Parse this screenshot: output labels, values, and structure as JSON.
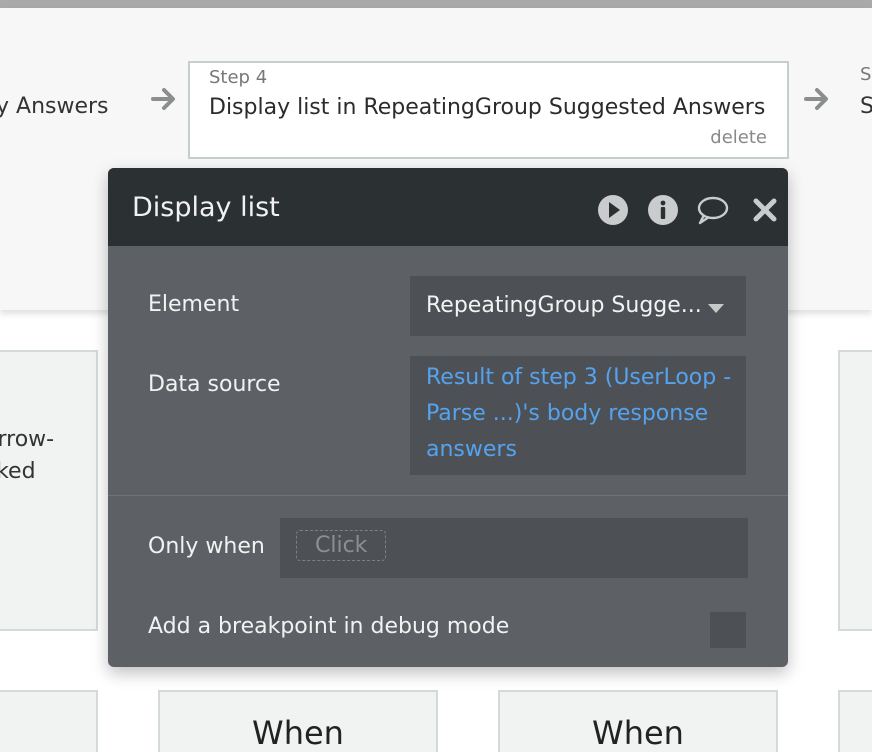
{
  "workflow": {
    "prev_step_label": "y Answers",
    "current_step": {
      "number_label": "Step 4",
      "title": "Display list in RepeatingGroup Suggested Answers",
      "delete_label": "delete"
    },
    "next_step": {
      "number_label": "S",
      "title": "S"
    }
  },
  "background_cards": {
    "left_card_text_line1": "arrow-",
    "left_card_text_line2": "cked",
    "when_label_1": "When",
    "when_label_2": "When"
  },
  "popup": {
    "title": "Display list",
    "icons": [
      "play-icon",
      "info-icon",
      "comment-icon",
      "close-icon"
    ],
    "element": {
      "label": "Element",
      "value": "RepeatingGroup Sugge..."
    },
    "data_source": {
      "label": "Data source",
      "value": "Result of step 3 (UserLoop - Parse ...)'s body response answers"
    },
    "only_when": {
      "label": "Only when",
      "placeholder": "Click"
    },
    "breakpoint": {
      "label": "Add a breakpoint in debug mode",
      "checked": false
    }
  },
  "colors": {
    "popup_bg": "#5d6166",
    "popup_header_bg": "#2b3033",
    "input_bg": "#4d5155",
    "link_blue": "#55a2ee",
    "step_border": "#c5d0cd"
  }
}
